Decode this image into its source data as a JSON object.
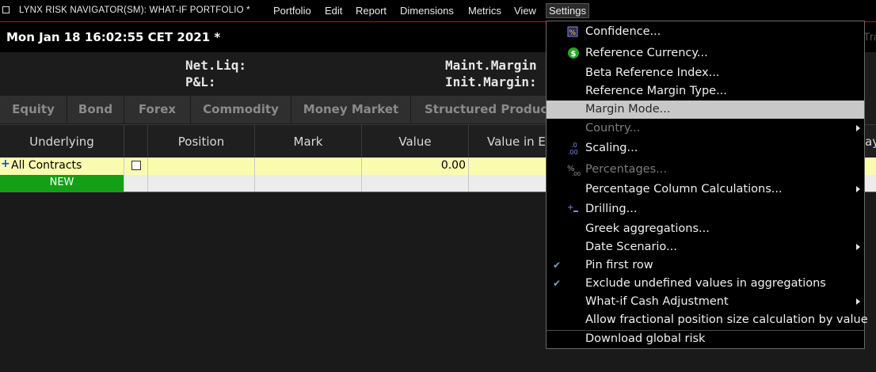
{
  "window": {
    "title": "LYNX RISK NAVIGATOR(SM): WHAT-IF PORTFOLIO *",
    "menus": [
      "Portfolio",
      "Edit",
      "Report",
      "Dimensions",
      "Metrics",
      "View",
      "Settings"
    ],
    "active_menu": "Settings"
  },
  "header": {
    "datetime": "Mon Jan 18 16:02:55 CET 2021 *",
    "right_fragment": "Tra"
  },
  "summary": {
    "net_liq_label": "Net.Liq:",
    "pnl_label": "P&L:",
    "maint_margin_label": "Maint.Margin",
    "init_margin_label": "Init.Margin:"
  },
  "tabs": [
    "Equity",
    "Bond",
    "Forex",
    "Commodity",
    "Money Market",
    "Structured Product"
  ],
  "table": {
    "columns": [
      "Underlying",
      "",
      "Position",
      "Mark",
      "Value",
      "Value in EU"
    ],
    "right_col_fragment": "ay",
    "rows": [
      {
        "underlying": "All Contracts",
        "position": "",
        "mark": "",
        "value": "0.00"
      },
      {
        "underlying": "NEW"
      }
    ]
  },
  "settings_menu": {
    "items": [
      {
        "label": "Confidence...",
        "icon": "confidence-icon",
        "enabled": true
      },
      {
        "label": "Reference Currency...",
        "icon": "currency-icon",
        "enabled": true
      },
      {
        "label": "Beta Reference Index...",
        "enabled": true
      },
      {
        "label": "Reference Margin Type...",
        "enabled": true
      },
      {
        "label": "Margin Mode...",
        "enabled": true,
        "highlighted": true
      },
      {
        "label": "Country...",
        "enabled": false,
        "submenu": true
      },
      {
        "label": "Scaling...",
        "icon": "scaling-icon",
        "enabled": true
      },
      {
        "label": "Percentages...",
        "icon": "percentages-icon",
        "enabled": false
      },
      {
        "label": "Percentage Column Calculations...",
        "enabled": true,
        "submenu": true
      },
      {
        "label": "Drilling...",
        "icon": "drilling-icon",
        "enabled": true
      },
      {
        "label": "Greek aggregations...",
        "enabled": true
      },
      {
        "label": "Date Scenario...",
        "enabled": true,
        "submenu": true
      },
      {
        "label": "Pin first row",
        "enabled": true,
        "checked": true
      },
      {
        "label": "Exclude undefined values in aggregations",
        "enabled": true,
        "checked": true
      },
      {
        "label": "What-if Cash Adjustment",
        "enabled": true,
        "submenu": true
      },
      {
        "label": "Allow fractional position size calculation by value",
        "enabled": true
      },
      {
        "label": "Download global risk",
        "enabled": true
      }
    ]
  },
  "colors": {
    "accent_red": "#c21010",
    "row_yellow": "#fbfbb0",
    "new_green": "#14a014",
    "menu_highlight": "#c8c8c8"
  }
}
